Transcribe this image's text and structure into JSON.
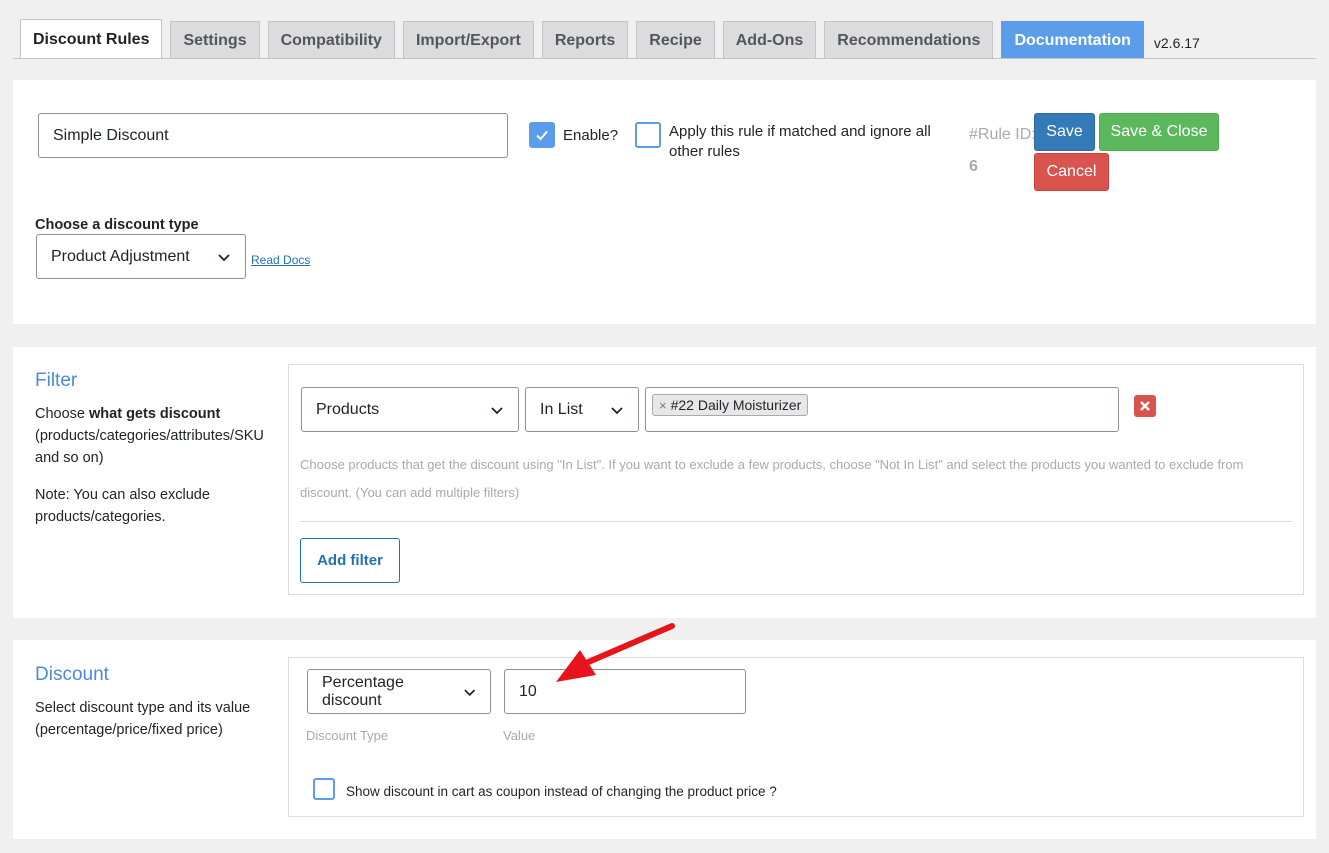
{
  "tabs": [
    {
      "label": "Discount Rules"
    },
    {
      "label": "Settings"
    },
    {
      "label": "Compatibility"
    },
    {
      "label": "Import/Export"
    },
    {
      "label": "Reports"
    },
    {
      "label": "Recipe"
    },
    {
      "label": "Add-Ons"
    },
    {
      "label": "Recommendations"
    },
    {
      "label": "Documentation"
    }
  ],
  "version": "v2.6.17",
  "rule": {
    "name": "Simple Discount",
    "enable_label": "Enable?",
    "enable_checked": true,
    "exclusive_label": "Apply this rule if matched and ignore all other rules",
    "exclusive_checked": false,
    "rule_id_label": "#Rule ID:",
    "rule_id_value": "6",
    "save_label": "Save",
    "save_close_label": "Save & Close",
    "cancel_label": "Cancel",
    "discount_type_heading": "Choose a discount type",
    "discount_type_value": "Product Adjustment",
    "read_docs": "Read Docs"
  },
  "filter": {
    "title": "Filter",
    "desc_prefix": "Choose ",
    "desc_bold": "what gets discount",
    "desc_rest": "(products/categories/attributes/SKU and so on)",
    "note": "Note: You can also exclude products/categories.",
    "type_value": "Products",
    "operator_value": "In List",
    "selected_item": "#22 Daily Moisturizer",
    "help_text": "Choose products that get the discount using \"In List\". If you want to exclude a few products, choose \"Not In List\" and select the products you wanted to exclude from discount. (You can add multiple filters)",
    "add_filter_label": "Add filter"
  },
  "discount": {
    "title": "Discount",
    "desc": "Select discount type and its value (percentage/price/fixed price)",
    "type_value": "Percentage discount",
    "value": "10",
    "type_label": "Discount Type",
    "value_label": "Value",
    "coupon_label": "Show discount in cart as coupon instead of changing the product price ?",
    "coupon_checked": false
  },
  "colors": {
    "accent": "#5b9dea",
    "save": "#337ab7",
    "save_close": "#5cb85c",
    "cancel": "#d9534f",
    "annotation_arrow": "#e8141b"
  }
}
